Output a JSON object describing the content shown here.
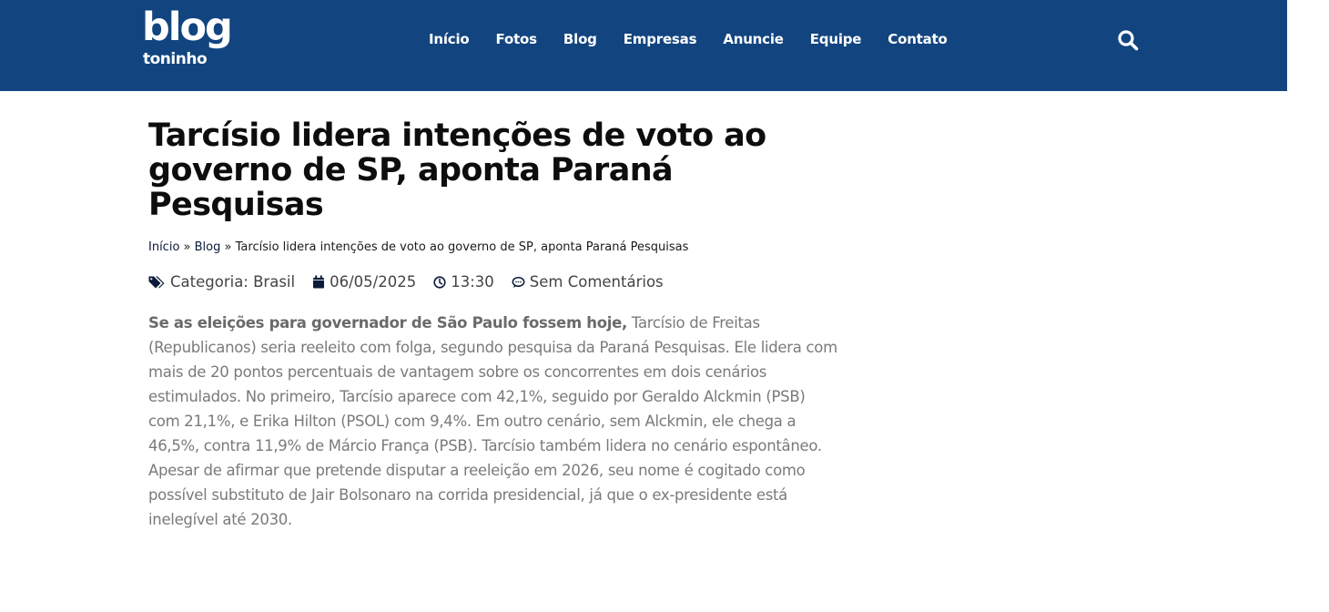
{
  "header": {
    "logo": {
      "top": "blog",
      "bottom": "toninho"
    },
    "nav": [
      "Início",
      "Fotos",
      "Blog",
      "Empresas",
      "Anuncie",
      "Equipe",
      "Contato"
    ],
    "search_icon": "search-icon",
    "colors": {
      "header_bg": "#124580",
      "text": "#ffffff"
    }
  },
  "article": {
    "title": "Tarcísio lidera intenções de voto ao governo de SP, aponta Paraná Pesquisas",
    "breadcrumb": {
      "home": "Início",
      "sep": "»",
      "section": "Blog",
      "current": "Tarcísio lidera intenções de voto ao governo de SP, aponta Paraná Pesquisas"
    },
    "meta": {
      "category": "Categoria: Brasil",
      "date": "06/05/2025",
      "time": "13:30",
      "comments": "Sem Comentários"
    },
    "lead_bold": "Se as eleições para governador de São Paulo fossem hoje,",
    "body": " Tarcísio de Freitas (Republicanos) seria reeleito com folga, segundo pesquisa da Paraná Pesquisas. Ele lidera com mais de 20 pontos percentuais de vantagem sobre os concorrentes em dois cenários estimulados. No primeiro, Tarcísio aparece com 42,1%, seguido por Geraldo Alckmin (PSB) com 21,1%, e Erika Hilton (PSOL) com 9,4%. Em outro cenário, sem Alckmin, ele chega a 46,5%, contra 11,9% de Márcio França (PSB). Tarcísio também lidera no cenário espontâneo. Apesar de afirmar que pretende disputar a reeleição em 2026, seu nome é cogitado como possível substituto de Jair Bolsonaro na corrida presidencial, já que o ex-presidente está inelegível até 2030."
  }
}
